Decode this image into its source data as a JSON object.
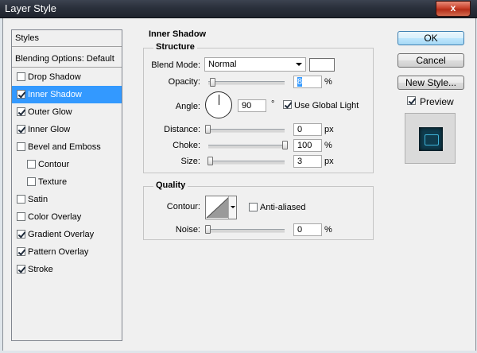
{
  "window": {
    "title": "Layer Style",
    "close_label": "x"
  },
  "styles_panel": {
    "header": "Styles",
    "blending_options": "Blending Options: Default",
    "items": [
      {
        "label": "Drop Shadow",
        "checked": false,
        "selected": false,
        "indent": false
      },
      {
        "label": "Inner Shadow",
        "checked": true,
        "selected": true,
        "indent": false
      },
      {
        "label": "Outer Glow",
        "checked": true,
        "selected": false,
        "indent": false
      },
      {
        "label": "Inner Glow",
        "checked": true,
        "selected": false,
        "indent": false
      },
      {
        "label": "Bevel and Emboss",
        "checked": false,
        "selected": false,
        "indent": false
      },
      {
        "label": "Contour",
        "checked": false,
        "selected": false,
        "indent": true
      },
      {
        "label": "Texture",
        "checked": false,
        "selected": false,
        "indent": true
      },
      {
        "label": "Satin",
        "checked": false,
        "selected": false,
        "indent": false
      },
      {
        "label": "Color Overlay",
        "checked": false,
        "selected": false,
        "indent": false
      },
      {
        "label": "Gradient Overlay",
        "checked": true,
        "selected": false,
        "indent": false
      },
      {
        "label": "Pattern Overlay",
        "checked": true,
        "selected": false,
        "indent": false
      },
      {
        "label": "Stroke",
        "checked": true,
        "selected": false,
        "indent": false
      }
    ]
  },
  "inner_shadow": {
    "title": "Inner Shadow",
    "structure": {
      "title": "Structure",
      "blend_mode_label": "Blend Mode:",
      "blend_mode_value": "Normal",
      "blend_color": "#ffffff",
      "opacity_label": "Opacity:",
      "opacity_value": "8",
      "opacity_unit": "%",
      "angle_label": "Angle:",
      "angle_value": "90",
      "angle_unit": "°",
      "use_global_light_label": "Use Global Light",
      "use_global_light_checked": true,
      "distance_label": "Distance:",
      "distance_value": "0",
      "distance_unit": "px",
      "choke_label": "Choke:",
      "choke_value": "100",
      "choke_unit": "%",
      "size_label": "Size:",
      "size_value": "3",
      "size_unit": "px"
    },
    "quality": {
      "title": "Quality",
      "contour_label": "Contour:",
      "anti_aliased_label": "Anti-aliased",
      "anti_aliased_checked": false,
      "noise_label": "Noise:",
      "noise_value": "0",
      "noise_unit": "%"
    }
  },
  "buttons": {
    "ok": "OK",
    "cancel": "Cancel",
    "new_style": "New Style...",
    "preview_label": "Preview",
    "preview_checked": true
  },
  "colors": {
    "selection": "#3399ff",
    "title_bar": "#2a303b",
    "close_button": "#c9412b",
    "preview_swatch": "#0f3c4e"
  }
}
